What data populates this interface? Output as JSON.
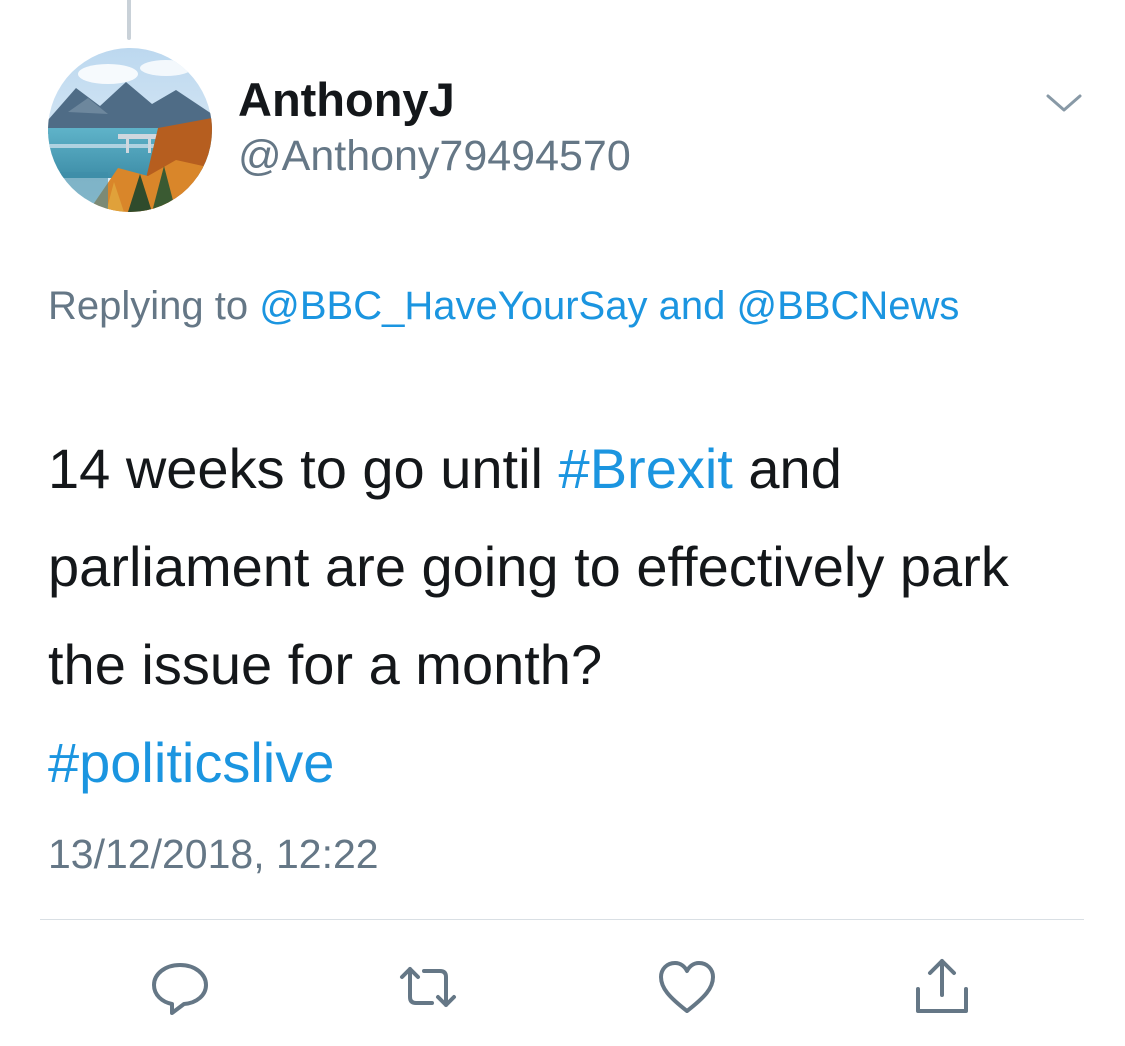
{
  "author": {
    "display_name": "AnthonyJ",
    "handle": "@Anthony79494570"
  },
  "reply": {
    "prefix": "Replying to",
    "mentions": [
      "@BBC_HaveYourSay",
      "@BBCNews"
    ],
    "conjunction": "and"
  },
  "tweet": {
    "text_before": "14 weeks to go until ",
    "hashtag_1": "#Brexit",
    "text_after": " and parliament are going to effectively park the issue for a month?",
    "hashtag_2": "#politicslive"
  },
  "timestamp": "13/12/2018, 12:22",
  "actions": {
    "reply_icon": "comment-bubble-icon",
    "retweet_icon": "retweet-arrows-icon",
    "like_icon": "heart-icon",
    "share_icon": "share-upload-icon"
  },
  "colors": {
    "link": "#1b95e0",
    "text_primary": "#14171a",
    "text_secondary": "#657786",
    "icon": "#657786"
  }
}
